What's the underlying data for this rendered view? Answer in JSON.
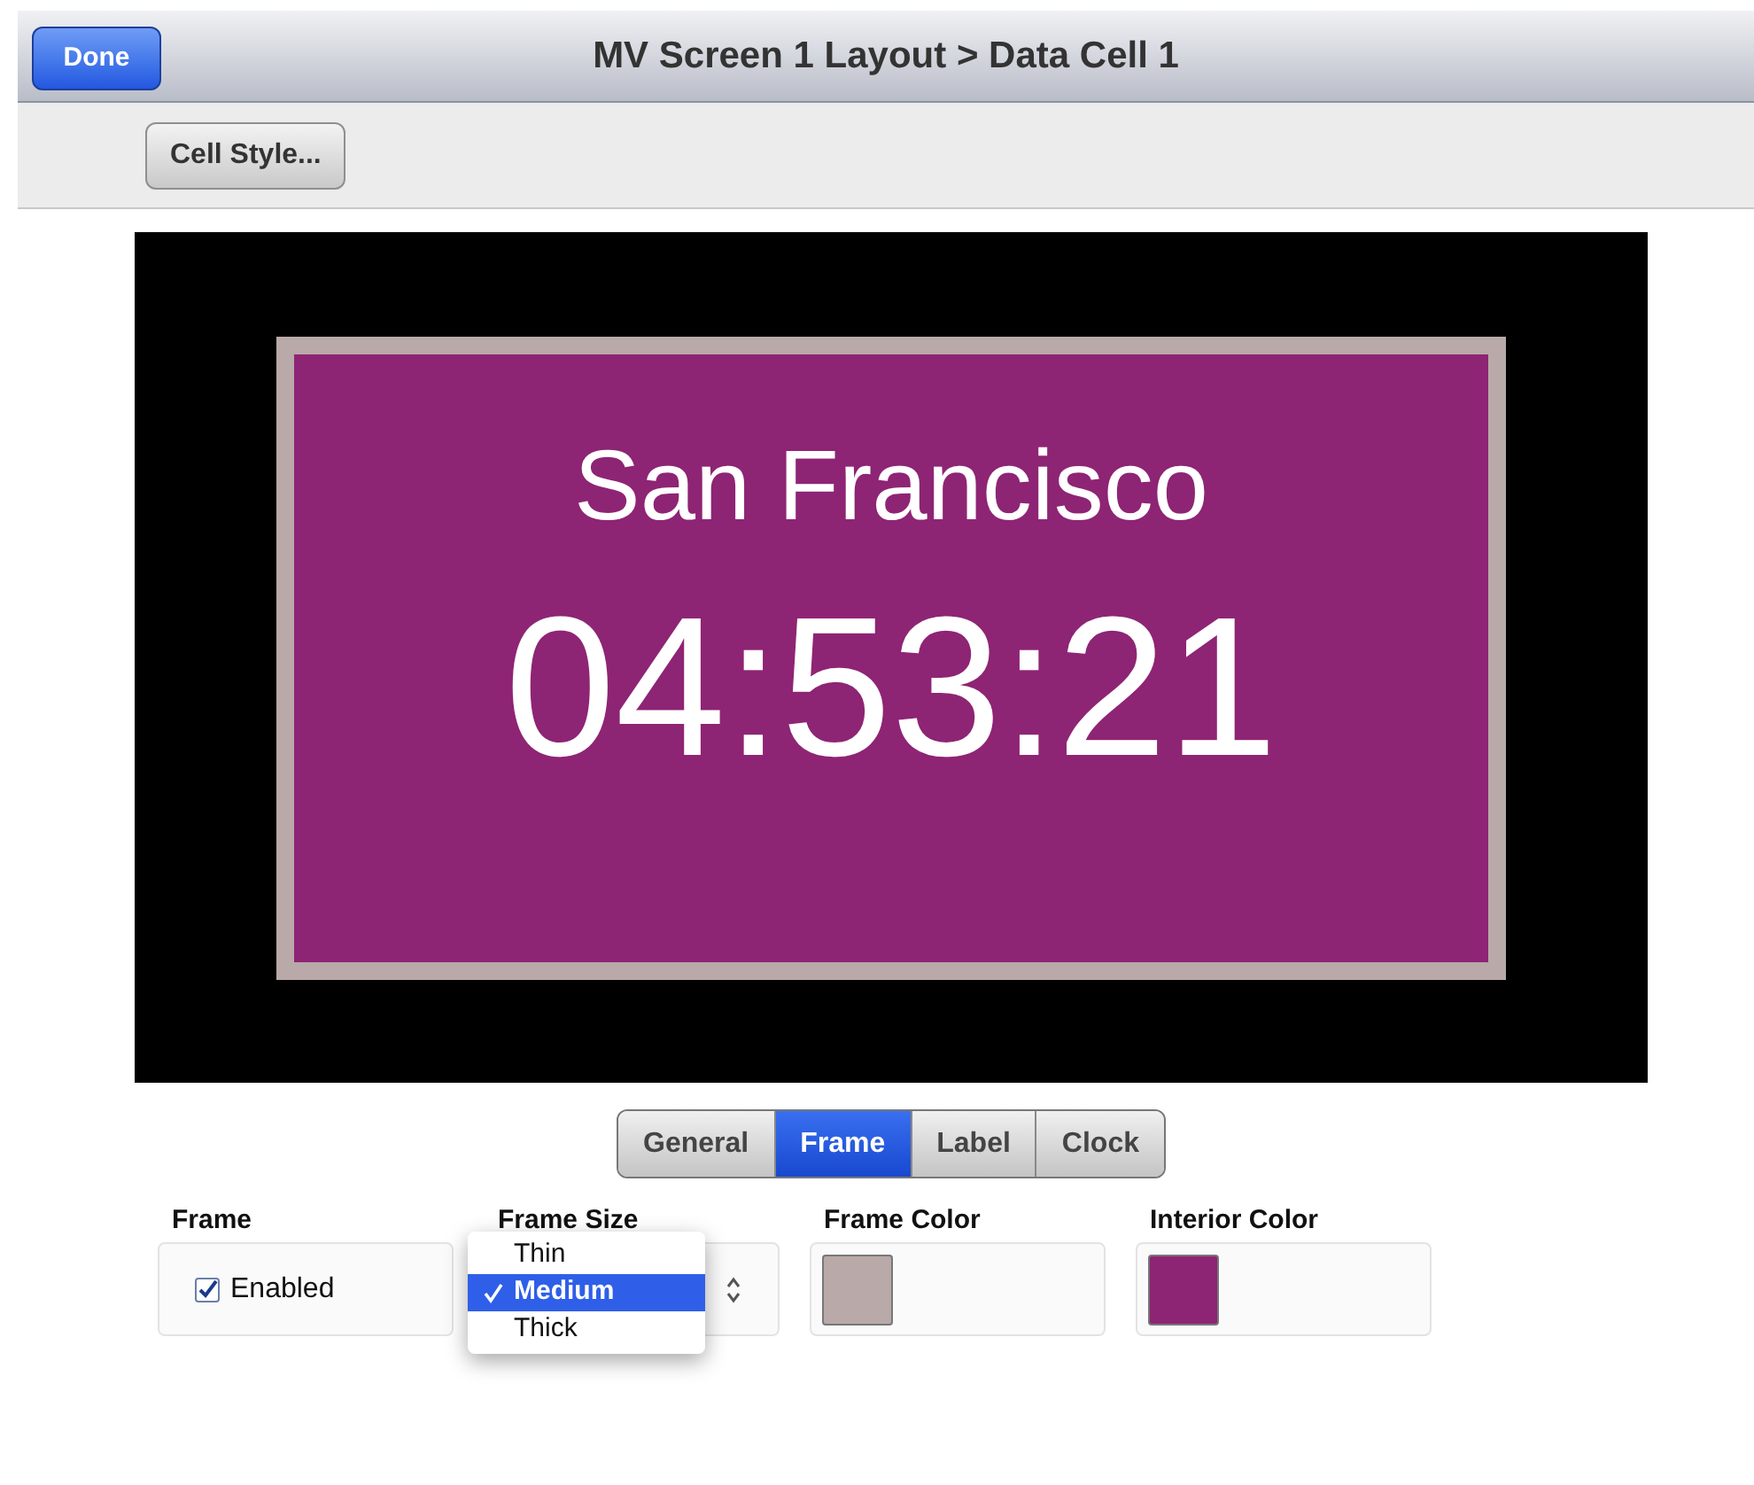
{
  "header": {
    "done_button": "Done",
    "title": "MV Screen 1 Layout > Data Cell 1"
  },
  "toolbar": {
    "cell_style_button": "Cell Style..."
  },
  "preview": {
    "label": "San Francisco",
    "clock": "04:53:21"
  },
  "tabs": [
    {
      "label": "General",
      "selected": false
    },
    {
      "label": "Frame",
      "selected": true
    },
    {
      "label": "Label",
      "selected": false
    },
    {
      "label": "Clock",
      "selected": false
    }
  ],
  "fields": [
    {
      "kind": "checkbox",
      "label": "Frame",
      "option": "Enabled",
      "checked": true
    },
    {
      "kind": "select",
      "label": "Frame Size",
      "options": [
        {
          "label": "Thin",
          "selected": false
        },
        {
          "label": "Medium",
          "selected": true
        },
        {
          "label": "Thick",
          "selected": false
        }
      ]
    },
    {
      "kind": "color",
      "label": "Frame Color",
      "color": "#b9a9a9"
    },
    {
      "kind": "color",
      "label": "Interior Color",
      "color": "#8e2474"
    }
  ]
}
